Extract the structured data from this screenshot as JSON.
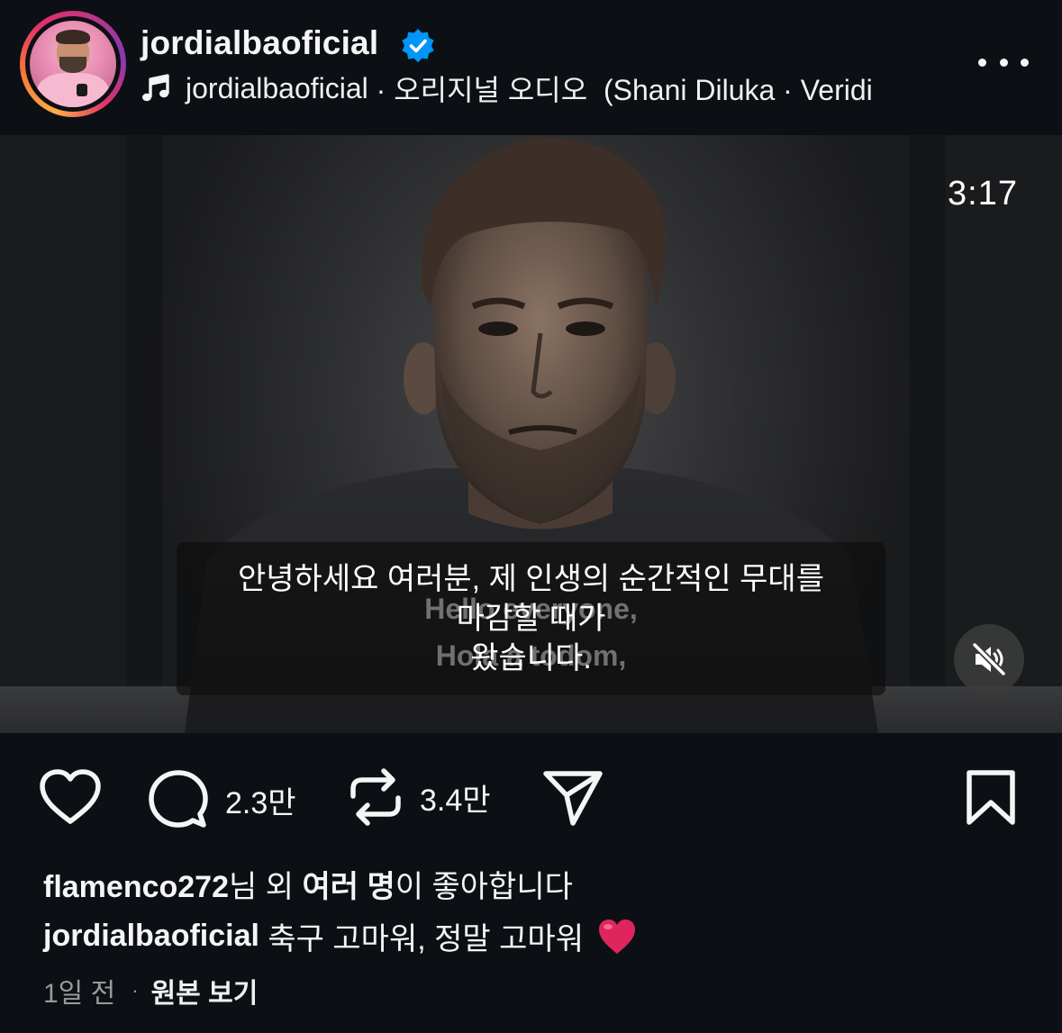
{
  "header": {
    "username": "jordialbaoficial",
    "audio_artist": "jordialbaoficial",
    "audio_label": " · 오리지널 오디오  (Shani Diluka · Veridi"
  },
  "video": {
    "time_remaining": "3:17",
    "caption_lines": [
      "안녕하세요 여러분, 제 인생의 순간적인 무대를",
      "마감할 때가",
      "왔습니다."
    ],
    "burned_caption_lines": [
      "Hello everyone,",
      "Hola a todom,"
    ],
    "muted": true
  },
  "actions": {
    "comments_count": "2.3만",
    "reposts_count": "3.4만"
  },
  "likes": {
    "user": "flamenco272",
    "text_a": "님 외 ",
    "bold_b": "여러 명",
    "text_c": "이 좋아합니다"
  },
  "caption": {
    "user": "jordialbaoficial",
    "text": " 축구 고마워, 정말 고마워",
    "emoji": "heart-emoji"
  },
  "meta": {
    "time_ago": "1일 전",
    "separator": "·",
    "view_original": "원본 보기"
  },
  "colors": {
    "background": "#0c1014",
    "verified": "#0095f6",
    "heart_emoji": "#e0245e"
  }
}
